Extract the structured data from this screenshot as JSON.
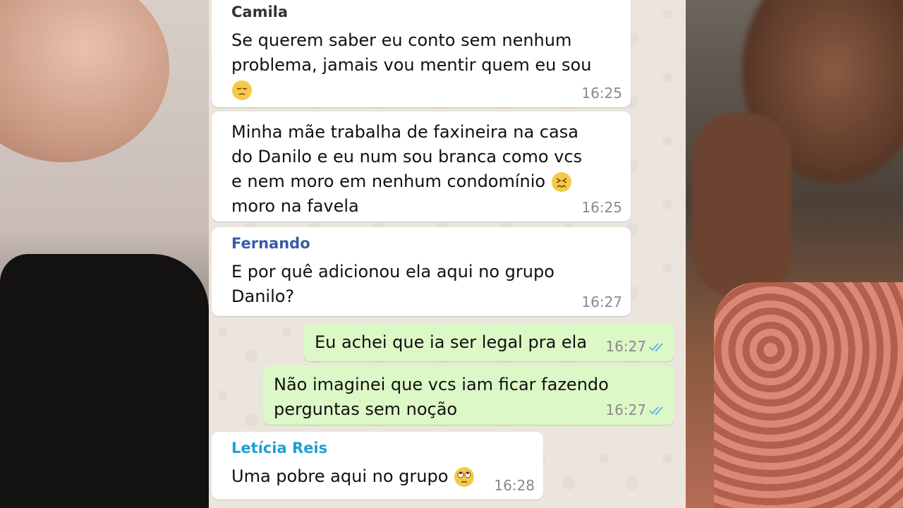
{
  "messages": [
    {
      "sender": "Camila",
      "sender_color": "#333333",
      "direction": "in",
      "lines": [
        "Se querem saber eu conto sem nenhum",
        "problema, jamais vou mentir quem eu sou"
      ],
      "emoji": "pensive-emoji",
      "time": "16:25"
    },
    {
      "sender": "",
      "direction": "in",
      "lines": [
        "Minha mãe trabalha de faxineira na casa",
        "do Danilo e eu num sou branca como vcs",
        "e nem moro em nenhum condomínio",
        "moro na favela"
      ],
      "emoji": "confounded-emoji",
      "time": "16:25"
    },
    {
      "sender": "Fernando",
      "sender_color": "#3b5ba8",
      "direction": "in",
      "lines": [
        "E por quê adicionou ela aqui no grupo",
        "Danilo?"
      ],
      "time": "16:27"
    },
    {
      "sender": "",
      "direction": "out",
      "lines": [
        "Eu achei que ia ser legal pra ela"
      ],
      "time": "16:27",
      "status": "read"
    },
    {
      "sender": "",
      "direction": "out",
      "lines": [
        "Não imaginei que vcs iam ficar fazendo",
        "perguntas sem noção"
      ],
      "time": "16:27",
      "status": "read"
    },
    {
      "sender": "Letícia Reis",
      "sender_color": "#1e9fd6",
      "direction": "in",
      "lines": [
        "Uma pobre aqui no grupo"
      ],
      "emoji": "eye-roll-emoji",
      "time": "16:28"
    }
  ],
  "colors": {
    "chat_bg": "#ece5dd",
    "incoming": "#ffffff",
    "outgoing": "#dcf8c6",
    "read_ticks": "#4fb6ec"
  }
}
